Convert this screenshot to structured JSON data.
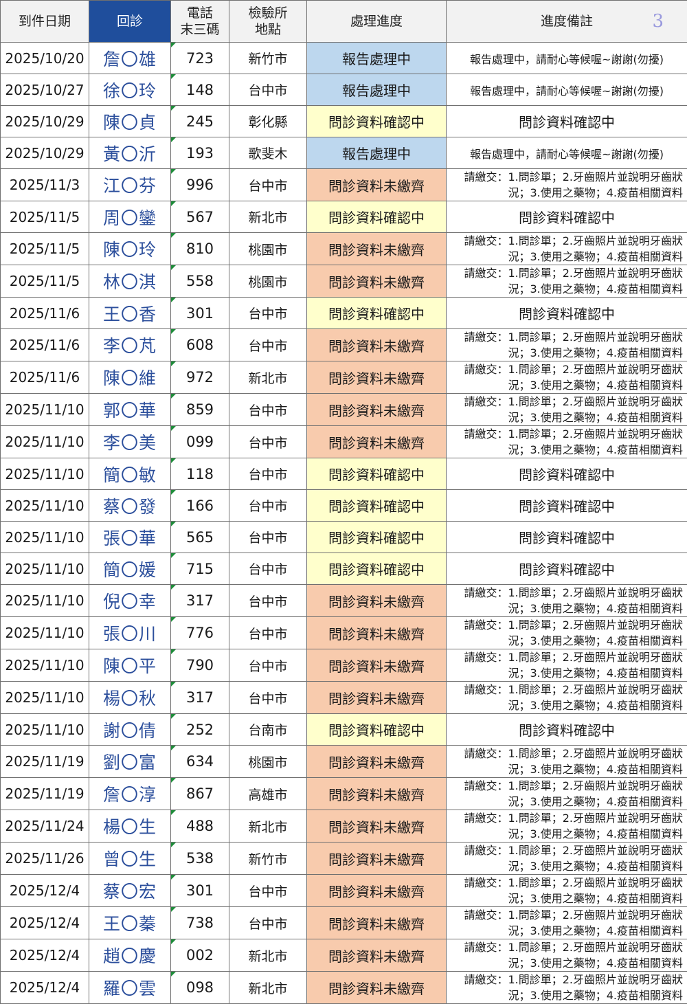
{
  "page_number": "3",
  "header": {
    "date": "到件日期",
    "name": "回診",
    "tel_line1": "電話",
    "tel_line2": "末三碼",
    "loc_line1": "檢驗所",
    "loc_line2": "地點",
    "status": "處理進度",
    "note": "進度備註"
  },
  "status_colors": {
    "report": "#bdd7ee",
    "confirm": "#ffffcc",
    "missing": "#f8cbad",
    "header_accent": "#1f4e9c"
  },
  "status_labels": {
    "report": "報告處理中",
    "confirm": "問診資料確認中",
    "missing": "問診資料未繳齊"
  },
  "notes": {
    "report": "報告處理中，請耐心等候喔~謝謝(勿擾)",
    "confirm": "問診資料確認中",
    "missing": "請繳交：1.問診單；2.牙齒照片並說明牙齒狀況；3.使用之藥物；4.疫苗相關資料"
  },
  "rows": [
    {
      "date": "2025/10/20",
      "name": "詹〇雄",
      "tel": "723",
      "loc": "新竹市",
      "status": "report"
    },
    {
      "date": "2025/10/27",
      "name": "徐〇玲",
      "tel": "148",
      "loc": "台中市",
      "status": "report"
    },
    {
      "date": "2025/10/29",
      "name": "陳〇貞",
      "tel": "245",
      "loc": "彰化縣",
      "status": "confirm"
    },
    {
      "date": "2025/10/29",
      "name": "黃〇沂",
      "tel": "193",
      "loc": "歌斐木",
      "status": "report"
    },
    {
      "date": "2025/11/3",
      "name": "江〇芬",
      "tel": "996",
      "loc": "台中市",
      "status": "missing"
    },
    {
      "date": "2025/11/5",
      "name": "周〇鑾",
      "tel": "567",
      "loc": "新北市",
      "status": "confirm"
    },
    {
      "date": "2025/11/5",
      "name": "陳〇玲",
      "tel": "810",
      "loc": "桃園市",
      "status": "missing"
    },
    {
      "date": "2025/11/5",
      "name": "林〇淇",
      "tel": "558",
      "loc": "桃園市",
      "status": "missing"
    },
    {
      "date": "2025/11/6",
      "name": "王〇香",
      "tel": "301",
      "loc": "台中市",
      "status": "confirm"
    },
    {
      "date": "2025/11/6",
      "name": "李〇芃",
      "tel": "608",
      "loc": "台中市",
      "status": "missing"
    },
    {
      "date": "2025/11/6",
      "name": "陳〇維",
      "tel": "972",
      "loc": "新北市",
      "status": "missing"
    },
    {
      "date": "2025/11/10",
      "name": "郭〇華",
      "tel": "859",
      "loc": "台中市",
      "status": "missing"
    },
    {
      "date": "2025/11/10",
      "name": "李〇美",
      "tel": "099",
      "loc": "台中市",
      "status": "missing"
    },
    {
      "date": "2025/11/10",
      "name": "簡〇敏",
      "tel": "118",
      "loc": "台中市",
      "status": "confirm"
    },
    {
      "date": "2025/11/10",
      "name": "蔡〇發",
      "tel": "166",
      "loc": "台中市",
      "status": "confirm"
    },
    {
      "date": "2025/11/10",
      "name": "張〇華",
      "tel": "565",
      "loc": "台中市",
      "status": "confirm"
    },
    {
      "date": "2025/11/10",
      "name": "簡〇媛",
      "tel": "715",
      "loc": "台中市",
      "status": "confirm"
    },
    {
      "date": "2025/11/10",
      "name": "倪〇幸",
      "tel": "317",
      "loc": "台中市",
      "status": "missing"
    },
    {
      "date": "2025/11/10",
      "name": "張〇川",
      "tel": "776",
      "loc": "台中市",
      "status": "missing"
    },
    {
      "date": "2025/11/10",
      "name": "陳〇平",
      "tel": "790",
      "loc": "台中市",
      "status": "missing"
    },
    {
      "date": "2025/11/10",
      "name": "楊〇秋",
      "tel": "317",
      "loc": "台中市",
      "status": "missing"
    },
    {
      "date": "2025/11/10",
      "name": "謝〇倩",
      "tel": "252",
      "loc": "台南市",
      "status": "confirm"
    },
    {
      "date": "2025/11/19",
      "name": "劉〇富",
      "tel": "634",
      "loc": "桃園市",
      "status": "missing"
    },
    {
      "date": "2025/11/19",
      "name": "詹〇淳",
      "tel": "867",
      "loc": "高雄市",
      "status": "missing"
    },
    {
      "date": "2025/11/24",
      "name": "楊〇生",
      "tel": "488",
      "loc": "新北市",
      "status": "missing"
    },
    {
      "date": "2025/11/26",
      "name": "曾〇生",
      "tel": "538",
      "loc": "新竹市",
      "status": "missing"
    },
    {
      "date": "2025/12/4",
      "name": "蔡〇宏",
      "tel": "301",
      "loc": "台中市",
      "status": "missing"
    },
    {
      "date": "2025/12/4",
      "name": "王〇蓁",
      "tel": "738",
      "loc": "台中市",
      "status": "missing"
    },
    {
      "date": "2025/12/4",
      "name": "趙〇慶",
      "tel": "002",
      "loc": "新北市",
      "status": "missing"
    },
    {
      "date": "2025/12/4",
      "name": "羅〇雲",
      "tel": "098",
      "loc": "新北市",
      "status": "missing"
    }
  ]
}
